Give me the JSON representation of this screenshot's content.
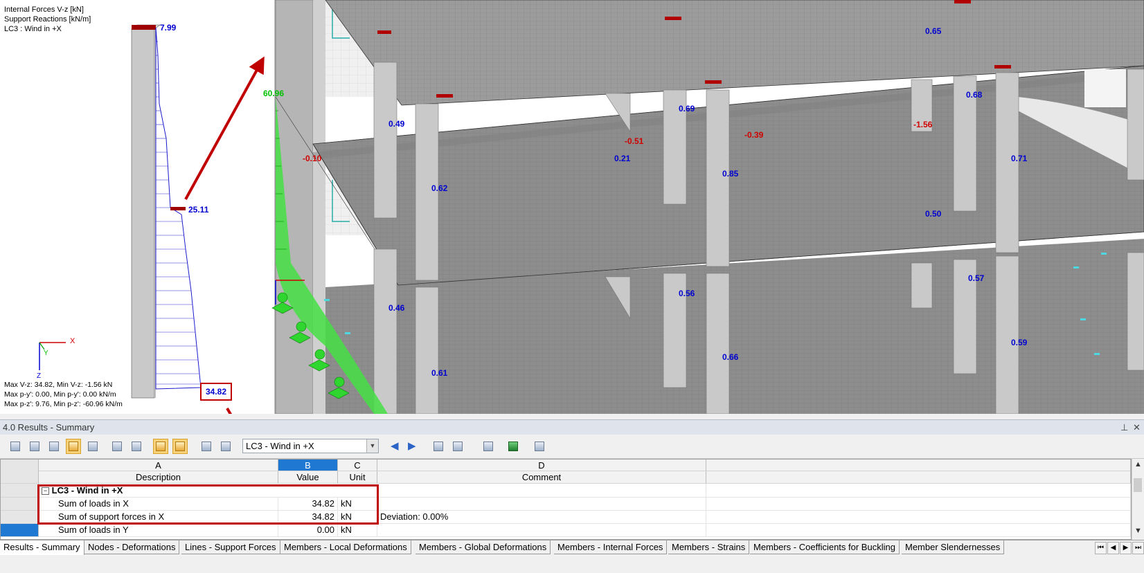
{
  "viewport": {
    "info_lines": [
      "Internal Forces V-z [kN]",
      "Support Reactions [kN/m]",
      "LC3 : Wind in +X"
    ],
    "stats": [
      "Max V-z: 34.82, Min V-z: -1.56 kN",
      "Max p-y': 0.00, Min p-y': 0.00 kN/m",
      "Max p-z': 9.76, Min p-z': -60.96 kN/m"
    ],
    "wall_labels": {
      "top": "7.99",
      "mid": "25.11",
      "bottom": "34.82"
    },
    "axis_labels": {
      "x": "X",
      "y": "Y",
      "z": "Z"
    },
    "green_labels": [
      "60.96"
    ],
    "blue_values": [
      "0.65",
      "0.49",
      "0.69",
      "0.68",
      "0.21",
      "0.85",
      "0.71",
      "0.62",
      "0.50",
      "0.46",
      "0.56",
      "0.57",
      "0.66",
      "0.59",
      "0.61"
    ],
    "red_values": [
      "-0.51",
      "-0.39",
      "-1.56",
      "-0.10"
    ]
  },
  "panel": {
    "title": "4.0 Results - Summary",
    "pin_icon": "pin-icon",
    "close_icon": "close-icon"
  },
  "toolbar": {
    "loadcase_selected": "LC3 - Wind in +X"
  },
  "table": {
    "col_letters": [
      "A",
      "B",
      "C",
      "D"
    ],
    "col_titles": [
      "Description",
      "Value",
      "Unit",
      "Comment"
    ],
    "group": "LC3 - Wind in +X",
    "rows": [
      {
        "description": "Sum of loads in X",
        "value": "34.82",
        "unit": "kN",
        "comment": ""
      },
      {
        "description": "Sum of support forces in X",
        "value": "34.82",
        "unit": "kN",
        "comment": "Deviation:  0.00%"
      },
      {
        "description": "Sum of loads in Y",
        "value": "0.00",
        "unit": "kN",
        "comment": ""
      }
    ]
  },
  "tabs": [
    "Results - Summary",
    "Nodes - Deformations",
    "Lines - Support Forces",
    "Members - Local Deformations",
    "Members - Global Deformations",
    "Members - Internal Forces",
    "Members - Strains",
    "Members - Coefficients for Buckling",
    "Member Slendernesses"
  ],
  "colors": {
    "accent": "#1f78d1",
    "highlight_box": "#c00000",
    "value_blue": "#0000d0",
    "value_red": "#d00000",
    "support_green": "#00c000"
  }
}
